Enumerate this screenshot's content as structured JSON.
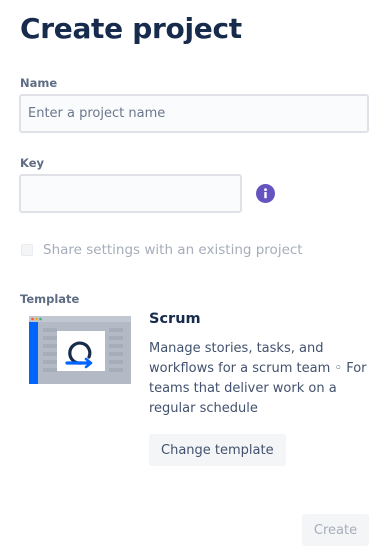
{
  "page": {
    "title": "Create project"
  },
  "form": {
    "name_label": "Name",
    "name_placeholder": "Enter a project name",
    "name_value": "",
    "key_label": "Key",
    "key_value": "",
    "share_settings_label": "Share settings with an existing project",
    "share_settings_checked": false
  },
  "template": {
    "section_label": "Template",
    "name": "Scrum",
    "description": "Manage stories, tasks, and workflows for a scrum team ◦ For teams that deliver work on a regular schedule",
    "change_button_label": "Change template"
  },
  "footer": {
    "create_button_label": "Create",
    "create_disabled": true
  },
  "colors": {
    "title": "#172b4d",
    "info_icon": "#6554c0",
    "template_accent": "#0065ff"
  }
}
